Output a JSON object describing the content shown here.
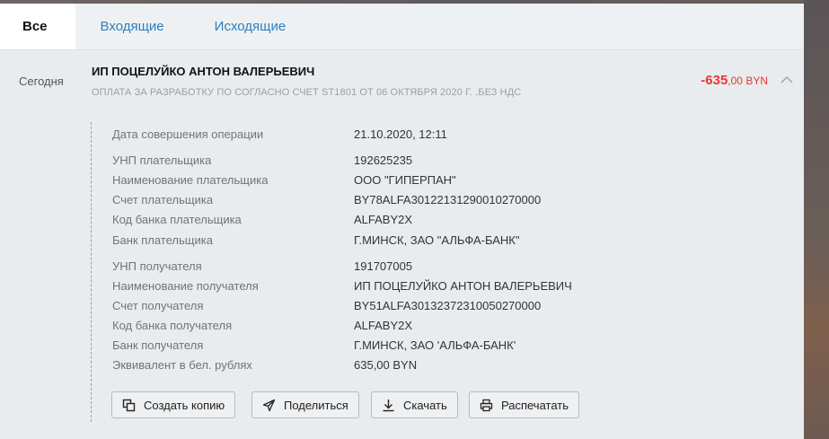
{
  "tabs": [
    {
      "label": "Все",
      "active": true
    },
    {
      "label": "Входящие",
      "active": false
    },
    {
      "label": "Исходящие",
      "active": false
    }
  ],
  "transaction": {
    "date_label": "Сегодня",
    "payee": "ИП ПОЦЕЛУЙКО АНТОН ВАЛЕРЬЕВИЧ",
    "purpose": "ОПЛАТА ЗА РАЗРАБОТКУ ПО СОГЛАСНО СЧЕТ ST1801 ОТ 06 ОКТЯБРЯ 2020 Г. ,БЕЗ НДС",
    "amount_int": "-635",
    "amount_dec": ",00 BYN"
  },
  "details": {
    "operation_date": {
      "label": "Дата совершения операции",
      "value": "21.10.2020, 12:11"
    },
    "payer": [
      {
        "label": "УНП плательщика",
        "value": "192625235"
      },
      {
        "label": "Наименование плательщика",
        "value": "ООО \"ГИПЕРПАН\""
      },
      {
        "label": "Счет плательщика",
        "value": "BY78ALFA30122131290010270000"
      },
      {
        "label": "Код банка плательщика",
        "value": "ALFABY2X"
      },
      {
        "label": "Банк плательщика",
        "value": "Г.МИНСК, ЗАО \"АЛЬФА-БАНК\""
      }
    ],
    "recipient": [
      {
        "label": "УНП получателя",
        "value": "191707005"
      },
      {
        "label": "Наименование получателя",
        "value": "ИП ПОЦЕЛУЙКО АНТОН ВАЛЕРЬЕВИЧ"
      },
      {
        "label": "Счет получателя",
        "value": "BY51ALFA30132372310050270000"
      },
      {
        "label": "Код банка получателя",
        "value": "ALFABY2X"
      },
      {
        "label": "Банк получателя",
        "value": "Г.МИНСК, ЗАО 'АЛЬФА-БАНК'"
      },
      {
        "label": "Эквивалент в бел. рублях",
        "value": "635,00 BYN"
      }
    ]
  },
  "actions": {
    "copy": "Создать копию",
    "share": "Поделиться",
    "download": "Скачать",
    "print": "Распечатать"
  },
  "icons": [
    "copy-icon",
    "share-icon",
    "download-icon",
    "print-icon",
    "chevron-up-icon"
  ],
  "colors": {
    "amount": "#e53935",
    "tab_link": "#2b7fbf"
  }
}
